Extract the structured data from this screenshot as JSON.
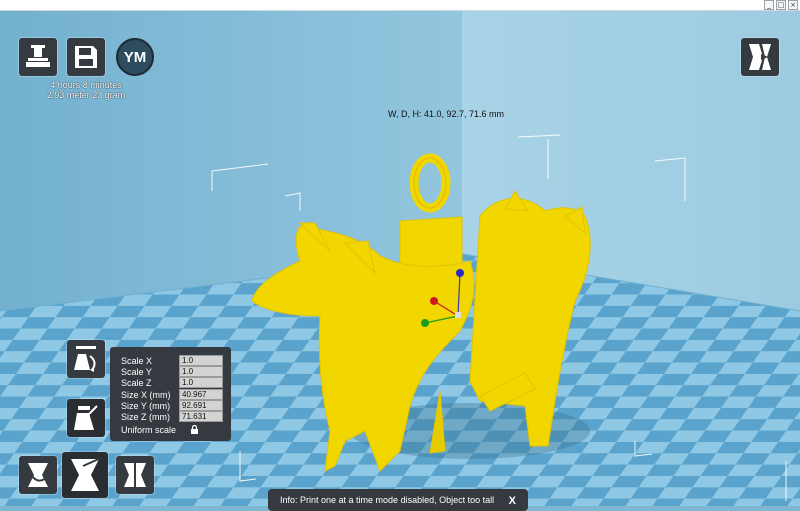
{
  "window": {
    "min_glyph": "_",
    "max_glyph": "□",
    "close_glyph": "×"
  },
  "toolbar": {
    "load_icon": "load-model-icon",
    "save_icon": "save-toolpath-icon",
    "account_initials": "YM",
    "view_mode_icon": "view-mode-icon"
  },
  "print_info": {
    "time": "4 hours 8 minutes",
    "material": "2.93 meter 23 gram"
  },
  "object": {
    "dimensions": "W, D, H: 41.0, 92.7, 71.6 mm"
  },
  "scale_panel": {
    "rows": [
      {
        "label": "Scale X",
        "value": "1.0"
      },
      {
        "label": "Scale Y",
        "value": "1.0"
      },
      {
        "label": "Scale Z",
        "value": "1.0"
      },
      {
        "label": "Size X (mm)",
        "value": "40.967"
      },
      {
        "label": "Size Y (mm)",
        "value": "92.691"
      },
      {
        "label": "Size Z (mm)",
        "value": "71.631"
      }
    ],
    "uniform_label": "Uniform scale"
  },
  "tools": {
    "rotate": "rotate-tool-icon",
    "scale": "scale-tool-icon",
    "mirror": "mirror-tool-icon"
  },
  "info_bar": {
    "message": "Info: Print one at a time mode disabled, Object too tall",
    "close": "X"
  },
  "colors": {
    "model": "#f1d600",
    "panel": "#343a40",
    "floor_dark": "#5aa3cc",
    "floor_light": "#8ec8e4",
    "wall": "#86bdd8"
  }
}
